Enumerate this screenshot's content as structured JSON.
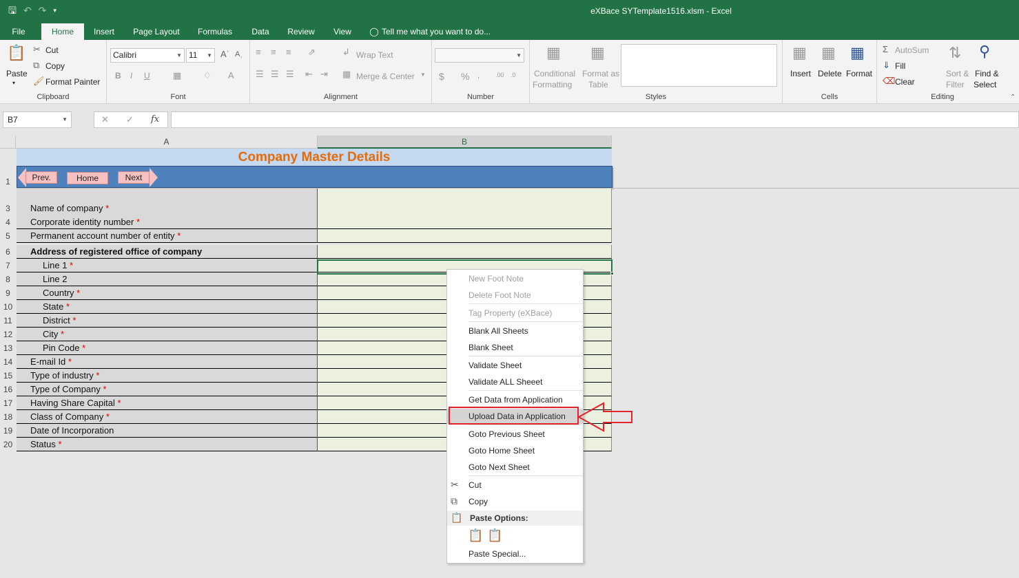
{
  "window": {
    "title": "eXBace SYTemplate1516.xlsm  -  Excel"
  },
  "tabs": [
    "File",
    "Home",
    "Insert",
    "Page Layout",
    "Formulas",
    "Data",
    "Review",
    "View",
    "Tell me what you want to do..."
  ],
  "ribbon": {
    "clipboard": {
      "paste": "Paste",
      "cut": "Cut",
      "copy": "Copy",
      "format_painter": "Format Painter",
      "label": "Clipboard"
    },
    "font": {
      "name": "Calibri",
      "size": "11",
      "label": "Font",
      "bold": "B",
      "italic": "I",
      "underline": "U"
    },
    "alignment": {
      "wrap_text": "Wrap Text",
      "merge_center": "Merge & Center",
      "label": "Alignment"
    },
    "number": {
      "currency": "$",
      "percent": "%",
      "label": "Number"
    },
    "styles": {
      "conditional": "Conditional",
      "formatting": "Formatting",
      "format_as": "Format as",
      "table": "Table",
      "label": "Styles"
    },
    "cells": {
      "insert": "Insert",
      "delete": "Delete",
      "format": "Format",
      "label": "Cells"
    },
    "editing": {
      "autosum": "AutoSum",
      "fill": "Fill",
      "clear": "Clear",
      "sort": "Sort &",
      "filter": "Filter",
      "find": "Find &",
      "select": "Select",
      "label": "Editing"
    }
  },
  "formula_bar": {
    "name_box": "B7",
    "fx": "fx",
    "value": ""
  },
  "columns": [
    "A",
    "B"
  ],
  "sheet": {
    "title": "Company Master Details",
    "nav": {
      "prev": "Prev.",
      "home": "Home",
      "next": "Next"
    },
    "rows": [
      {
        "num": "3",
        "label": "Name of company",
        "required": "*"
      },
      {
        "num": "4",
        "label": "Corporate identity number",
        "required": "*"
      },
      {
        "num": "5",
        "label": "Permanent account number of entity",
        "required": "*"
      },
      {
        "num": "6",
        "label": "Address of registered office of company",
        "required": ""
      },
      {
        "num": "7",
        "label": "Line 1",
        "required": "*"
      },
      {
        "num": "8",
        "label": "Line 2",
        "required": ""
      },
      {
        "num": "9",
        "label": "Country",
        "required": "*"
      },
      {
        "num": "10",
        "label": "State",
        "required": "*"
      },
      {
        "num": "11",
        "label": "District",
        "required": "*"
      },
      {
        "num": "12",
        "label": "City",
        "required": "*"
      },
      {
        "num": "13",
        "label": "Pin Code",
        "required": "*"
      },
      {
        "num": "14",
        "label": "E-mail Id",
        "required": "*"
      },
      {
        "num": "15",
        "label": "Type of industry",
        "required": "*"
      },
      {
        "num": "16",
        "label": "Type of Company",
        "required": "*"
      },
      {
        "num": "17",
        "label": "Having Share Capital",
        "required": "*"
      },
      {
        "num": "18",
        "label": "Class of Company",
        "required": "*"
      },
      {
        "num": "19",
        "label": "Date of Incorporation",
        "required": ""
      },
      {
        "num": "20",
        "label": "Status",
        "required": "*"
      }
    ]
  },
  "context_menu": {
    "items": [
      "New Foot Note",
      "Delete Foot Note",
      "Tag Property (eXBace)",
      "Blank All Sheets",
      "Blank Sheet",
      "Validate Sheet",
      "Validate ALL Sheeet",
      "Get Data from Application",
      "Upload Data in Application",
      "Goto Previous Sheet",
      "Goto Home Sheet",
      "Goto Next Sheet",
      "Cut",
      "Copy"
    ],
    "paste_options": "Paste Options:",
    "paste_special": "Paste Special..."
  },
  "colors": {
    "excel_green": "#217346",
    "banner_blue": "#4f81bd",
    "title_orange": "#e46c0a",
    "highlight_red": "#e3222a"
  }
}
